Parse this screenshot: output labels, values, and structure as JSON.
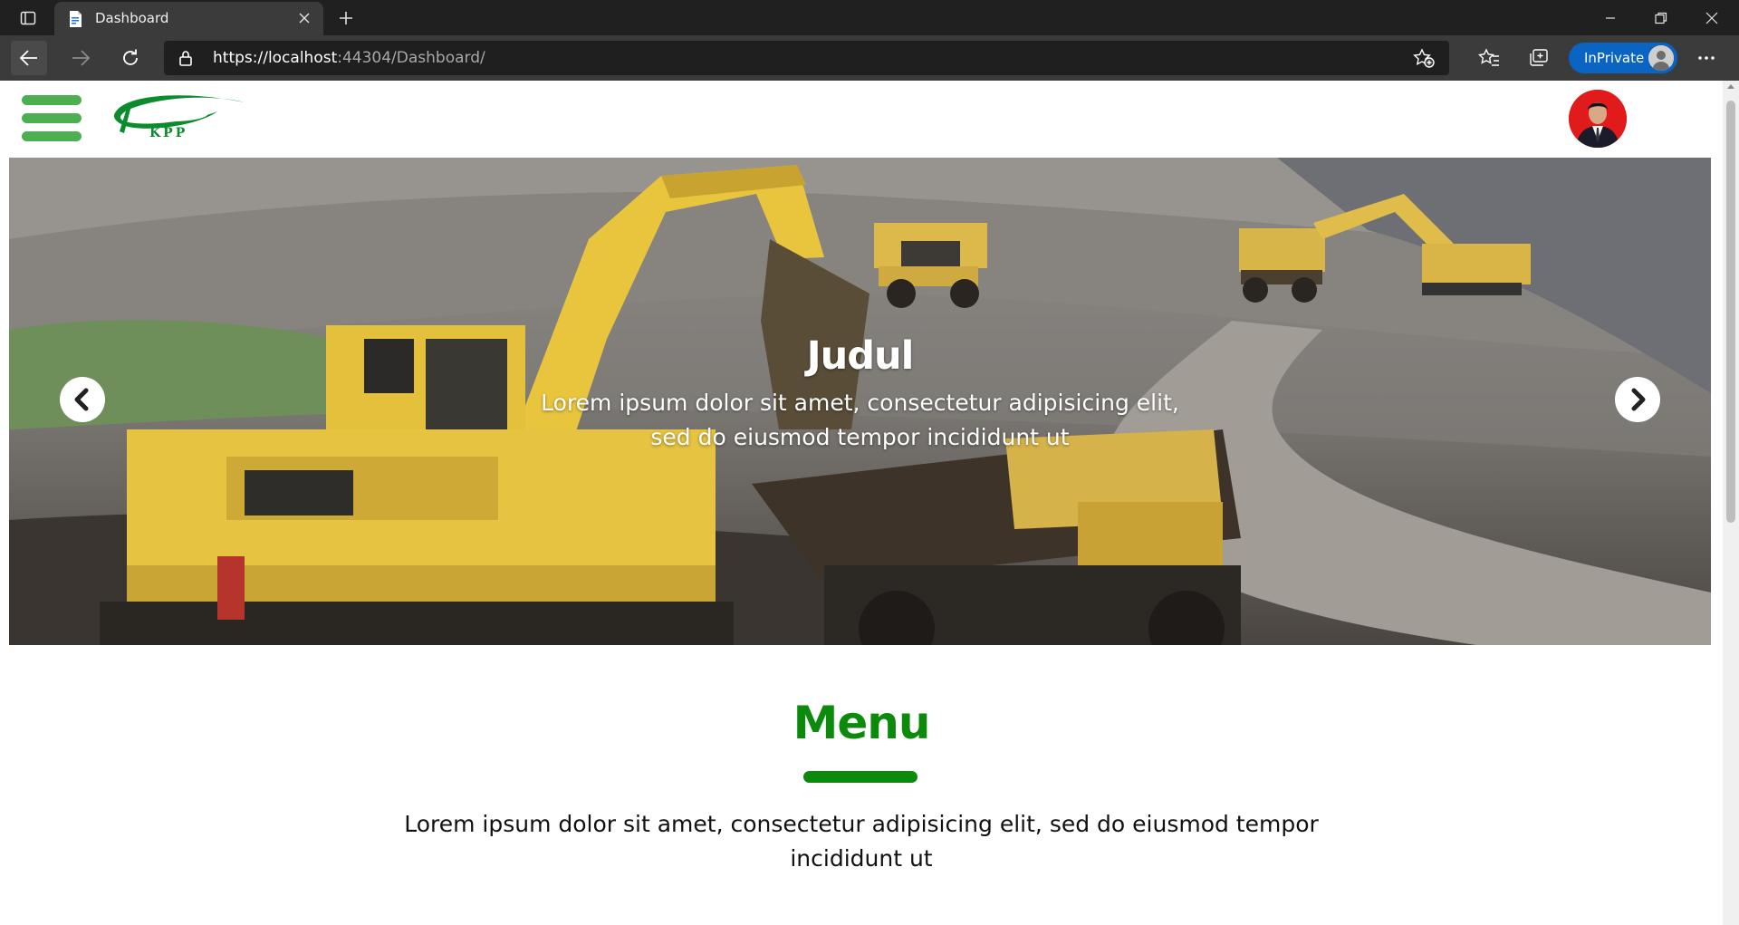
{
  "browser": {
    "tab_title": "Dashboard",
    "url_prefix": "https://",
    "url_host": "localhost",
    "url_rest": ":44304/Dashboard/",
    "inprivate_label": "InPrivate"
  },
  "header": {
    "logo_text": "KPP"
  },
  "carousel": {
    "title": "Judul",
    "text": "Lorem ipsum dolor sit amet, consectetur adipisicing elit, sed do eiusmod tempor incididunt ut"
  },
  "menu_section": {
    "title": "Menu",
    "description": "Lorem ipsum dolor sit amet, consectetur adipisicing elit, sed do eiusmod tempor incididunt ut"
  },
  "colors": {
    "brand_green": "#0b8a0b",
    "hamburger_green": "#4caf50",
    "inprivate_blue": "#0a64c2"
  }
}
